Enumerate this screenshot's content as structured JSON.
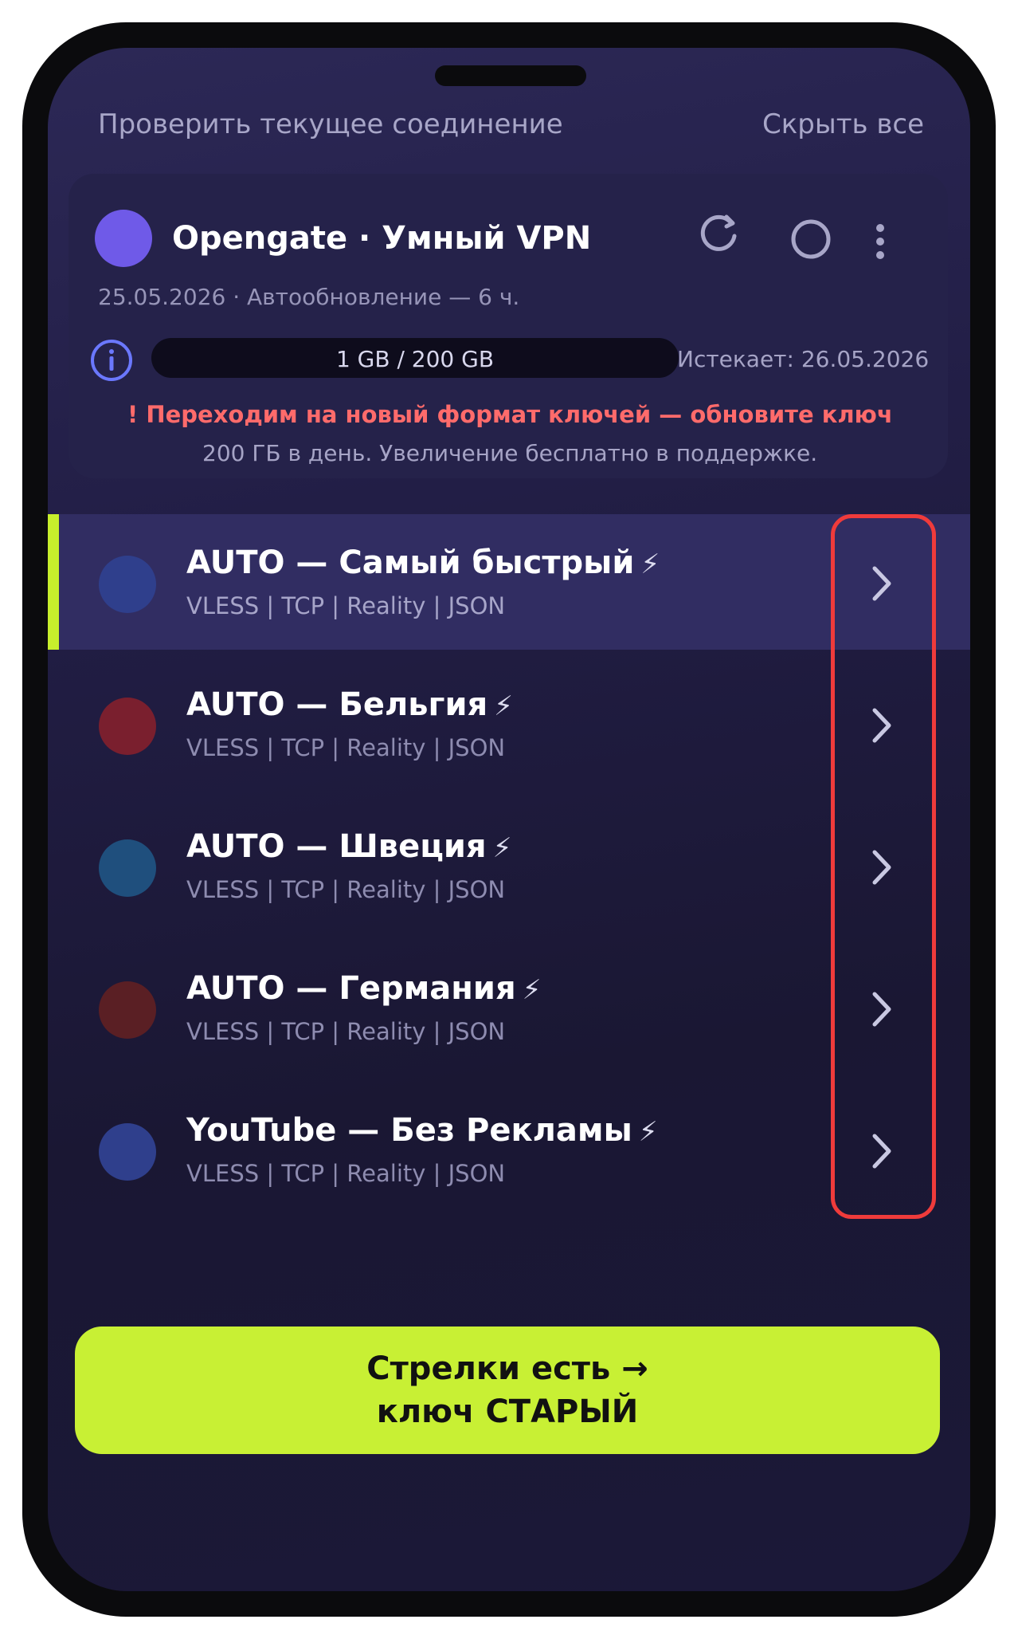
{
  "header": {
    "check_connection": "Проверить текущее соединение",
    "hide_all": "Скрыть все"
  },
  "subscription": {
    "title": "Opengate · Умный VPN",
    "updated": "25.05.2026 · Автообновление — 6 ч.",
    "traffic": "1 GB / 200 GB",
    "traffic_used_fraction": 0.005,
    "expires": "Истекает: 26.05.2026",
    "warning": "! Переходим на новый формат ключей — обновите ключ",
    "note": "200 ГБ в день. Увеличение бесплатно в поддержке.",
    "icons": [
      "refresh-icon",
      "power-icon",
      "more-vertical-icon",
      "info-icon"
    ],
    "logo_color": "#6f5ae8"
  },
  "servers": [
    {
      "name": "AUTO — Самый быстрый",
      "bolt": "⚡",
      "protocol": "VLESS | TCP | Reality | JSON",
      "color": "#2f3f8c",
      "selected": true
    },
    {
      "name": "AUTO — Бельгия",
      "bolt": "⚡",
      "protocol": "VLESS | TCP | Reality | JSON",
      "color": "#7a1f2e",
      "selected": false
    },
    {
      "name": "AUTO — Швеция",
      "bolt": "⚡",
      "protocol": "VLESS | TCP | Reality | JSON",
      "color": "#1f4f7d",
      "selected": false
    },
    {
      "name": "AUTO — Германия",
      "bolt": "⚡",
      "protocol": "VLESS | TCP | Reality | JSON",
      "color": "#5a1f24",
      "selected": false
    },
    {
      "name": "YouTube — Без Рекламы",
      "bolt": "⚡",
      "protocol": "VLESS | TCP | Reality | JSON",
      "color": "#2f3f8c",
      "selected": false
    }
  ],
  "cta": {
    "line1": "Стрелки есть →",
    "line2": "ключ СТАРЫЙ"
  },
  "colors": {
    "accent": "#c8f034",
    "warning": "#ff6b6b",
    "highlight": "#ef3b3b",
    "background": "#221e46"
  }
}
